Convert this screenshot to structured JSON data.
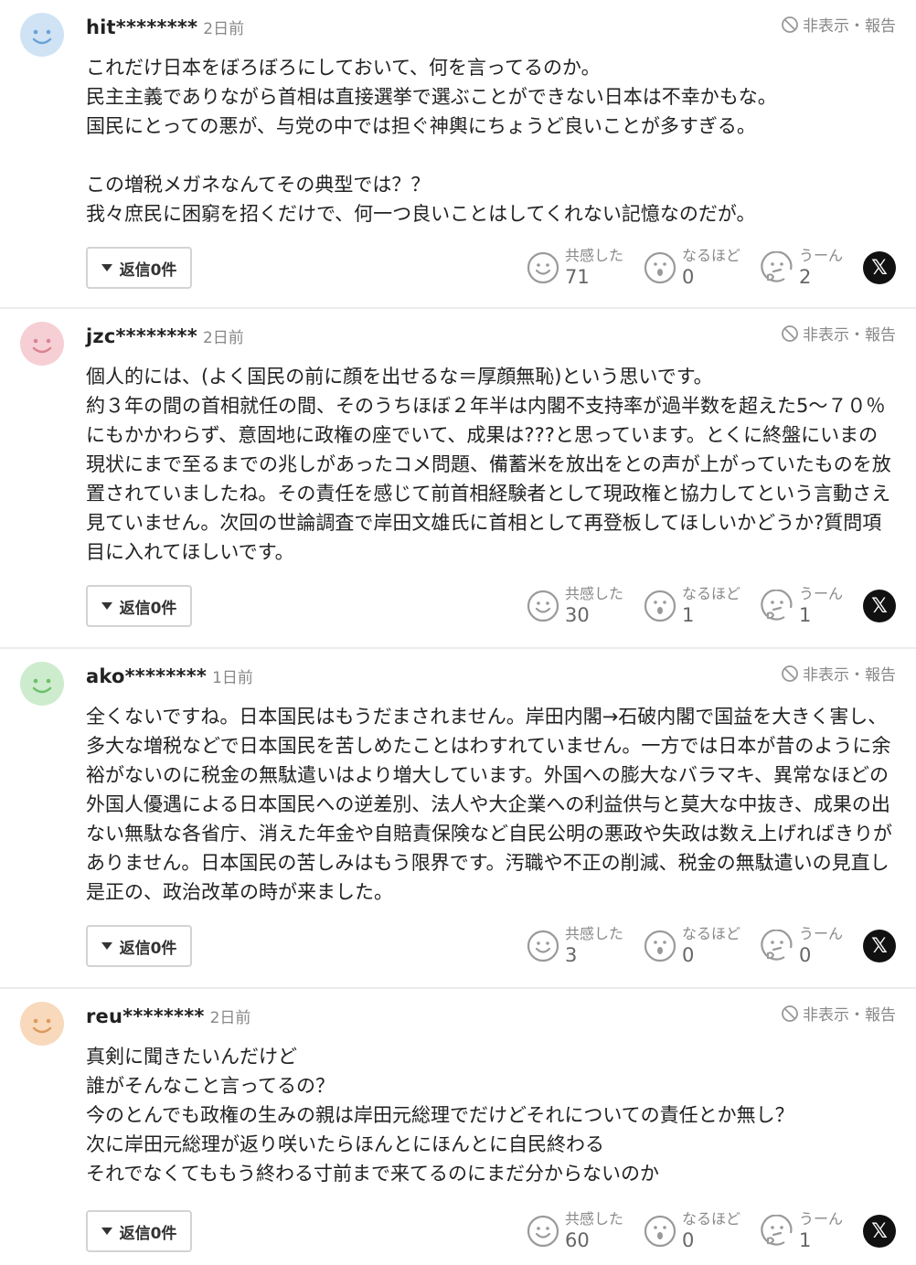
{
  "labels": {
    "hide_report": "非表示・報告",
    "reply_prefix": "返信",
    "react_agree": "共感した",
    "react_insight": "なるほど",
    "react_hmm": "うーん",
    "x_share": "𝕏"
  },
  "colors": {
    "avatar_blue": "#cfe3f5",
    "avatar_pink": "#f6cfd5",
    "avatar_green": "#cdebcd",
    "avatar_orange": "#f8d9bc",
    "icon_gray": "#9a9a9a"
  },
  "comments": [
    {
      "user": "hit********",
      "ago": "2日前",
      "body": "これだけ日本をぼろぼろにしておいて、何を言ってるのか。\n民主主義でありながら首相は直接選挙で選ぶことができない日本は不幸かもな。\n国民にとっての悪が、与党の中では担ぐ神輿にちょうど良いことが多すぎる。\n\nこの増税メガネなんてその典型では？？\n我々庶民に困窮を招くだけで、何一つ良いことはしてくれない記憶なのだが。",
      "replies": "0件",
      "agree": "71",
      "insight": "0",
      "hmm": "2"
    },
    {
      "user": "jzc********",
      "ago": "2日前",
      "body": "個人的には、(よく国民の前に顔を出せるな＝厚顔無恥)という思いです。\n約３年の間の首相就任の間、そのうちほぼ２年半は内閣不支持率が過半数を超えた5〜７０％にもかかわらず、意固地に政権の座でいて、成果は???と思っています。とくに終盤にいまの現状にまで至るまでの兆しがあったコメ問題、備蓄米を放出をとの声が上がっていたものを放置されていましたね。その責任を感じて前首相経験者として現政権と協力してという言動さえ見ていません。次回の世論調査で岸田文雄氏に首相として再登板してほしいかどうか?質問項目に入れてほしいです。",
      "replies": "0件",
      "agree": "30",
      "insight": "1",
      "hmm": "1"
    },
    {
      "user": "ako********",
      "ago": "1日前",
      "body": "全くないですね。日本国民はもうだまされません。岸田内閣→石破内閣で国益を大きく害し、多大な増税などで日本国民を苦しめたことはわすれていません。一方では日本が昔のように余裕がないのに税金の無駄遣いはより増大しています。外国への膨大なバラマキ、異常なほどの外国人優遇による日本国民への逆差別、法人や大企業への利益供与と莫大な中抜き、成果の出ない無駄な各省庁、消えた年金や自賠責保険など自民公明の悪政や失政は数え上げればきりがありません。日本国民の苦しみはもう限界です。汚職や不正の削減、税金の無駄遣いの見直し是正の、政治改革の時が来ました。",
      "replies": "0件",
      "agree": "3",
      "insight": "0",
      "hmm": "0"
    },
    {
      "user": "reu********",
      "ago": "2日前",
      "body": "真剣に聞きたいんだけど\n誰がそんなこと言ってるの？\n今のとんでも政権の生みの親は岸田元総理でだけどそれについての責任とか無し？\n次に岸田元総理が返り咲いたらほんとにほんとに自民終わる\nそれでなくてももう終わる寸前まで来てるのにまだ分からないのか",
      "replies": "0件",
      "agree": "60",
      "insight": "0",
      "hmm": "1"
    }
  ]
}
